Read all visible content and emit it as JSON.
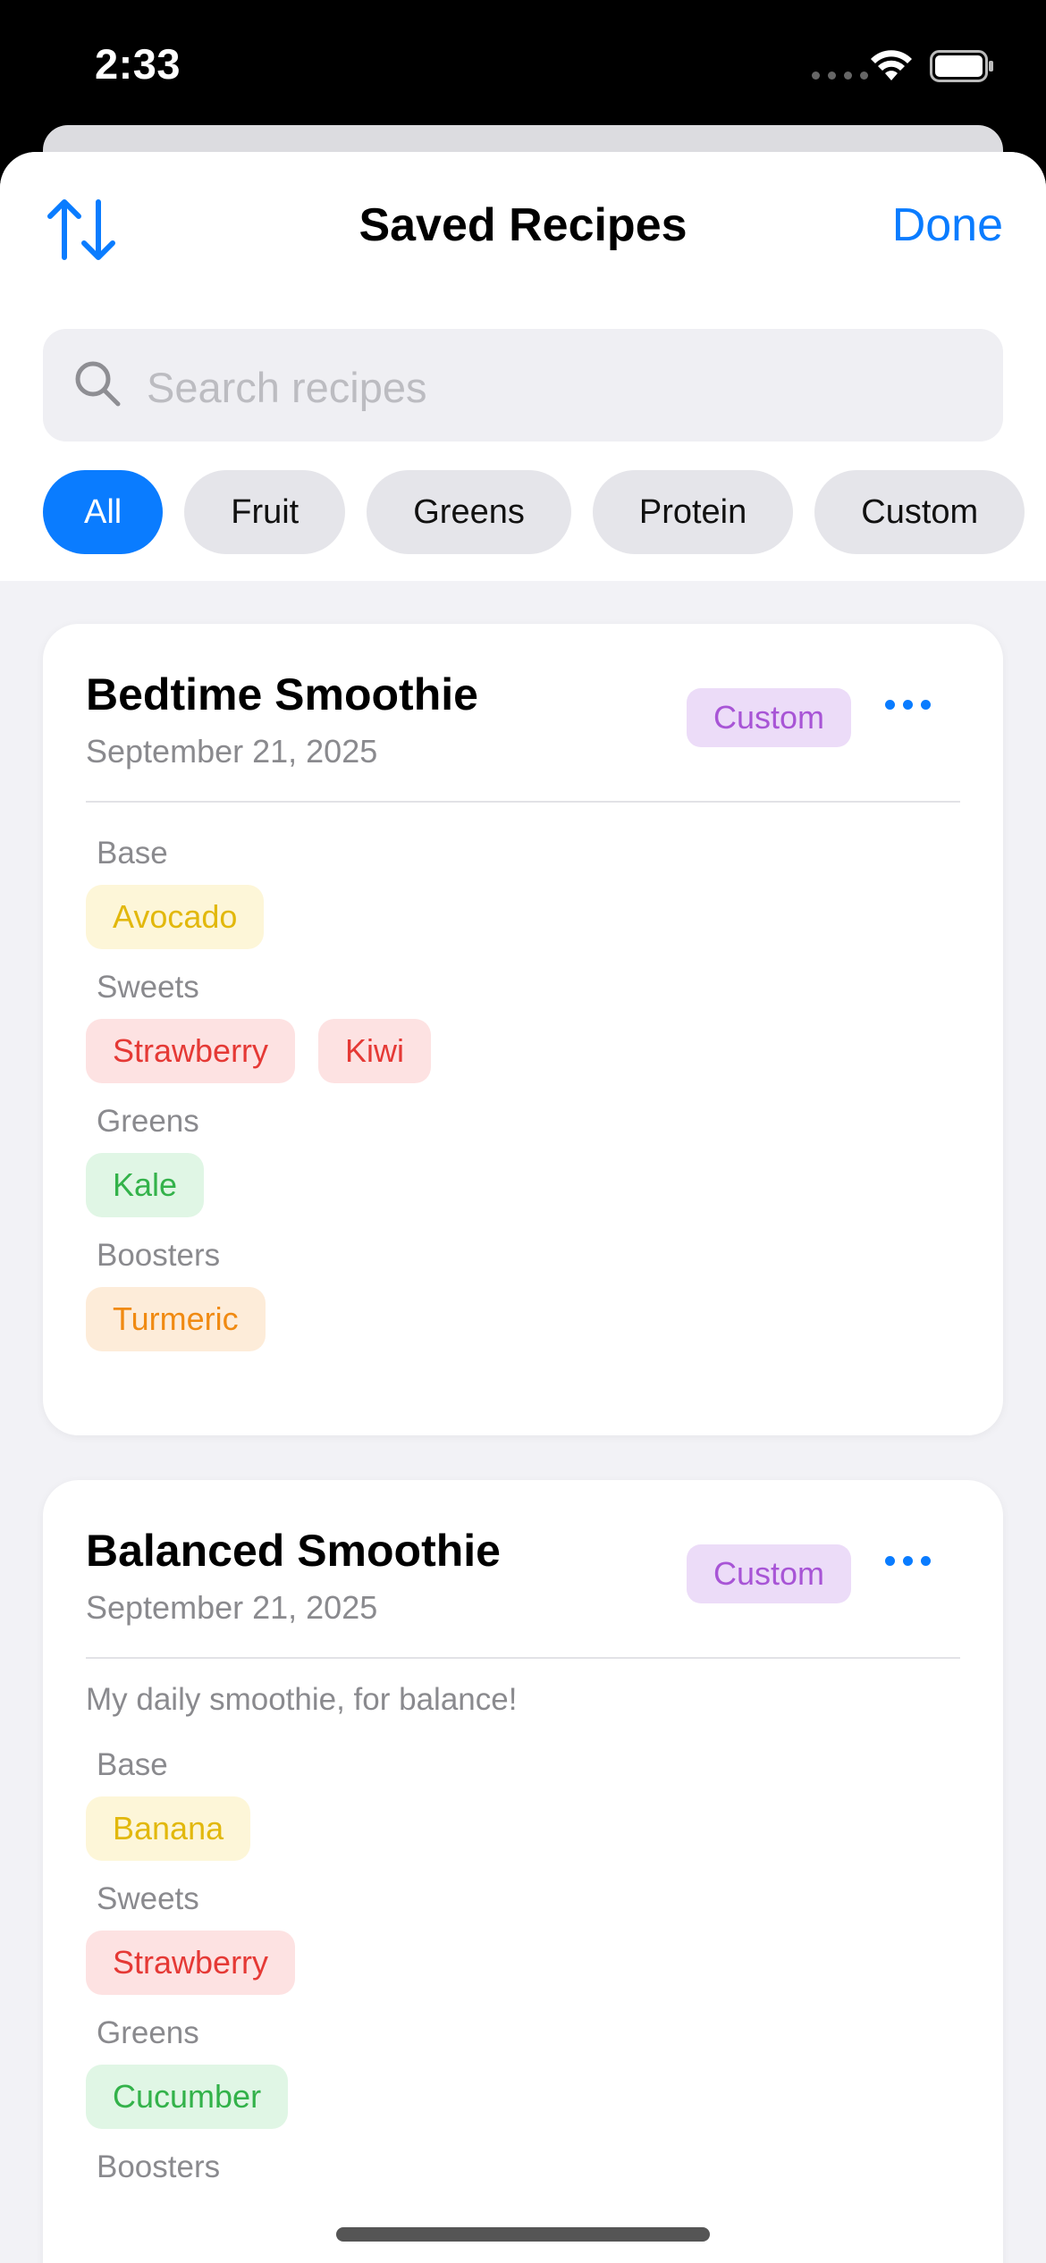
{
  "status_bar": {
    "time": "2:33"
  },
  "header": {
    "title": "Saved Recipes",
    "done_label": "Done",
    "sort_icon": "sort-arrows-icon"
  },
  "search": {
    "placeholder": "Search recipes",
    "value": ""
  },
  "filters": [
    {
      "label": "All",
      "active": true
    },
    {
      "label": "Fruit",
      "active": false
    },
    {
      "label": "Greens",
      "active": false
    },
    {
      "label": "Protein",
      "active": false
    },
    {
      "label": "Custom",
      "active": false
    }
  ],
  "recipes": [
    {
      "title": "Bedtime Smoothie",
      "date": "September 21, 2025",
      "badge": "Custom",
      "sections": [
        {
          "label": "Base",
          "items": [
            "Avocado"
          ],
          "color": "yellow"
        },
        {
          "label": "Sweets",
          "items": [
            "Strawberry",
            "Kiwi"
          ],
          "color": "red"
        },
        {
          "label": "Greens",
          "items": [
            "Kale"
          ],
          "color": "green"
        },
        {
          "label": "Boosters",
          "items": [
            "Turmeric"
          ],
          "color": "orange"
        }
      ]
    },
    {
      "title": "Balanced Smoothie",
      "date": "September 21, 2025",
      "badge": "Custom",
      "note": "My daily smoothie, for balance!",
      "sections": [
        {
          "label": "Base",
          "items": [
            "Banana"
          ],
          "color": "yellow"
        },
        {
          "label": "Sweets",
          "items": [
            "Strawberry"
          ],
          "color": "red"
        },
        {
          "label": "Greens",
          "items": [
            "Cucumber"
          ],
          "color": "green"
        },
        {
          "label": "Boosters",
          "items": [],
          "color": "orange"
        }
      ]
    }
  ],
  "colors": {
    "accent": "#0a7cff",
    "badge_purple": "#a855d6",
    "tag_yellow": "#e2b80c",
    "tag_red": "#e53935",
    "tag_green": "#33b24a",
    "tag_orange": "#f08a12"
  }
}
